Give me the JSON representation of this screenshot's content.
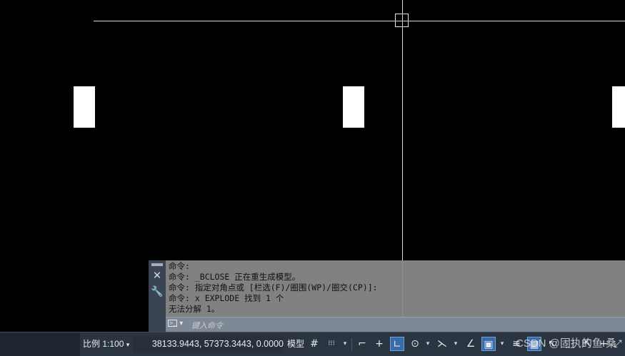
{
  "command_window": {
    "history": [
      "命令:",
      "命令: _BCLOSE 正在重生成模型。",
      "命令: 指定对角点或 [栏选(F)/圈围(WP)/圈交(CP)]:",
      "命令: x EXPLODE 找到 1 个",
      "无法分解 1。"
    ],
    "input_placeholder": "键入命令",
    "close_glyph": "✕",
    "wrench_glyph": "🔧",
    "prompt_glyph": ">_",
    "prompt_arrow": "▾"
  },
  "status_bar": {
    "scale_label": "比例 1:100",
    "scale_arrow": "▾",
    "coordinates": "38133.9443, 57373.3443, 0.0000",
    "model_label": "模型",
    "icons": {
      "grid": "#",
      "snap": "⁝⁝⁝",
      "infer": "⌐",
      "dynamic_input": "+",
      "ortho": "∟",
      "polar": "⊙",
      "isodraft": "⋋",
      "object_snap_track": "∠",
      "object_snap": "▣",
      "lineweight": "≡",
      "transparency": "▦",
      "selection_cycling": "↖",
      "annotation": "⬚",
      "plus": "+"
    }
  },
  "watermark": "CSDN @固执的鱼 桑",
  "colors": {
    "canvas_bg": "#000000",
    "crosshair": "#d9d9d9",
    "status_bg": "#2b3441",
    "active_toggle": "#3a6aa8"
  }
}
